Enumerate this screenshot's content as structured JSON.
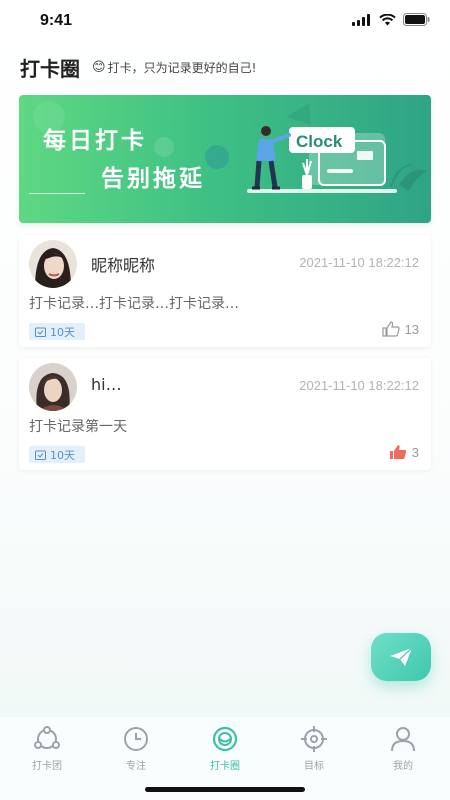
{
  "status_bar": {
    "time": "9:41"
  },
  "header": {
    "title": "打卡圈",
    "subtitle_emoji": "😊",
    "subtitle": "打卡，只为记录更好的自己!"
  },
  "banner": {
    "line1": "每日打卡",
    "line2": "告别拖延",
    "sign_text": "Clock"
  },
  "posts": [
    {
      "name": "昵称昵称",
      "date": "2021-11-10 18:22:12",
      "content": "打卡记录…打卡记录…打卡记录…",
      "badge": "10天",
      "likes": "13",
      "liked": false
    },
    {
      "name": "hi…",
      "date": "2021-11-10 18:22:12",
      "content": "打卡记录第一天",
      "badge": "10天",
      "likes": "3",
      "liked": true
    }
  ],
  "tabs": [
    {
      "label": "打卡团",
      "icon": "group-icon"
    },
    {
      "label": "专注",
      "icon": "clock-icon"
    },
    {
      "label": "打卡圈",
      "icon": "circle-icon",
      "active": true
    },
    {
      "label": "目标",
      "icon": "target-icon"
    },
    {
      "label": "我的",
      "icon": "profile-icon"
    }
  ],
  "colors": {
    "accent": "#3dbfa8",
    "like_active": "#f06b5f",
    "badge_bg": "#e3f0fb"
  }
}
